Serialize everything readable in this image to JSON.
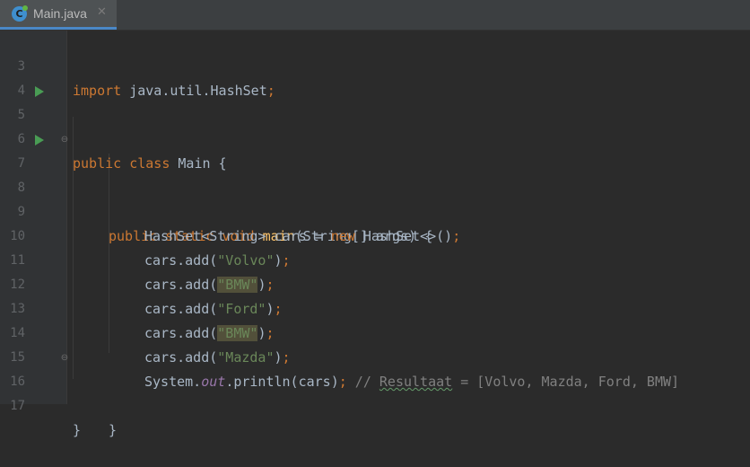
{
  "tab": {
    "icon": "C",
    "label": "Main.java",
    "close": "✕"
  },
  "lines": [
    {
      "num": "3"
    },
    {
      "num": "4"
    },
    {
      "num": "5"
    },
    {
      "num": "6"
    },
    {
      "num": "7"
    },
    {
      "num": "8"
    },
    {
      "num": "9"
    },
    {
      "num": "10"
    },
    {
      "num": "11"
    },
    {
      "num": "12"
    },
    {
      "num": "13"
    },
    {
      "num": "14"
    },
    {
      "num": "15"
    },
    {
      "num": "16"
    },
    {
      "num": "17"
    }
  ],
  "code": {
    "l3": {
      "kw": "import",
      "rest": " java.util.HashSet",
      "semi": ";"
    },
    "l5": {
      "kw": "public class",
      "rest": " Main {"
    },
    "l7": {
      "kw": "public static void",
      "fn": "main",
      "rest": "(String[] args) {"
    },
    "l9": {
      "a": "HashSet<String> cars = ",
      "kw": "new",
      "b": " HashSet<>()",
      "semi": ";"
    },
    "l10": {
      "a": "cars.add(",
      "str": "\"Volvo\"",
      "b": ")",
      "semi": ";"
    },
    "l11": {
      "a": "cars.add(",
      "str": "\"BMW\"",
      "b": ")",
      "semi": ";"
    },
    "l12": {
      "a": "cars.add(",
      "str": "\"Ford\"",
      "b": ")",
      "semi": ";"
    },
    "l13": {
      "a": "cars.add(",
      "str": "\"BMW\"",
      "b": ")",
      "semi": ";"
    },
    "l14": {
      "a": "cars.add(",
      "str": "\"Mazda\"",
      "b": ")",
      "semi": ";"
    },
    "l15": {
      "a": "System.",
      "field": "out",
      "b": ".println(cars)",
      "semi": ";",
      "c1": " // ",
      "c2": "Resultaat",
      "c3": " = [Volvo, Mazda, Ford, BMW]"
    },
    "l16": {
      "rest": "}"
    },
    "l17": {
      "rest": "}"
    }
  },
  "colors": {
    "background": "#2b2b2b",
    "keyword": "#cc7832",
    "string": "#6a8759",
    "function": "#ffc66d",
    "comment": "#808080",
    "static_field": "#9876aa",
    "run_icon": "#499c54"
  }
}
